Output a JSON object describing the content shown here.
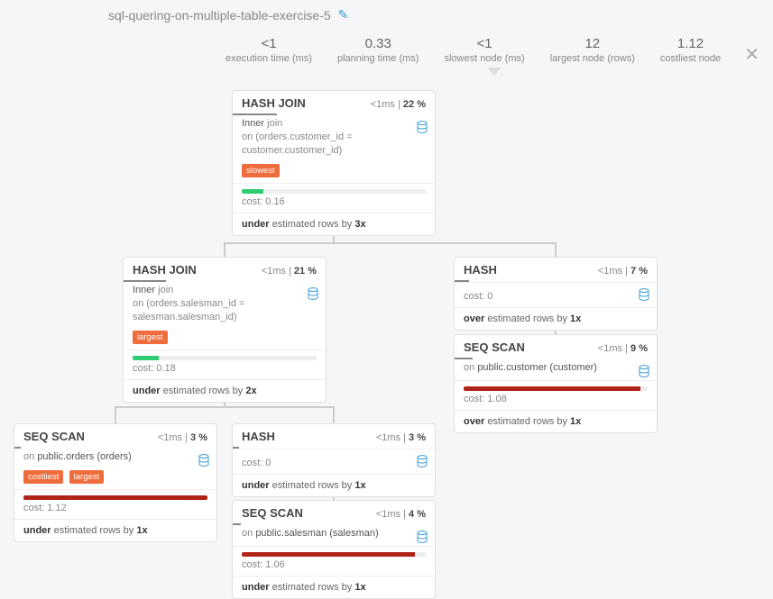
{
  "title": "sql-quering-on-multiple-table-exercise-5",
  "stats": {
    "exec": {
      "val": "<1",
      "label": "execution time (ms)"
    },
    "plan": {
      "val": "0.33",
      "label": "planning time (ms)"
    },
    "slow": {
      "val": "<1",
      "label": "slowest node (ms)"
    },
    "large": {
      "val": "12",
      "label": "largest node (rows)"
    },
    "costly": {
      "val": "1.12",
      "label": "costliest node"
    }
  },
  "badges": {
    "slowest": "slowest",
    "largest": "largest",
    "costliest": "costliest"
  },
  "nodes": {
    "n1": {
      "op": "HASH JOIN",
      "time": "<1ms",
      "pct": "22 %",
      "desc_kind": "Inner",
      "desc_kind2": "join",
      "desc_on": "on (orders.customer_id = customer.customer_id)",
      "badge_slowest": true,
      "bar_pct": 12,
      "bar_color": "#2ecc71",
      "cost": "0.16",
      "est_dir": "under",
      "est_tail": "estimated rows by",
      "est_x": "3x"
    },
    "n2": {
      "op": "HASH JOIN",
      "time": "<1ms",
      "pct": "21 %",
      "desc_kind": "Inner",
      "desc_kind2": "join",
      "desc_on": "on (orders.salesman_id = salesman.salesman_id)",
      "badge_largest": true,
      "bar_pct": 14,
      "bar_color": "#2ecc71",
      "cost": "0.18",
      "est_dir": "under",
      "est_tail": "estimated rows by",
      "est_x": "2x"
    },
    "n3": {
      "op": "HASH",
      "time": "<1ms",
      "pct": "7 %",
      "bar_pct": 4,
      "bar_color": "#2ecc71",
      "cost": "0",
      "est_dir": "over",
      "est_tail": "estimated rows by",
      "est_x": "1x"
    },
    "n4": {
      "op": "SEQ SCAN",
      "time": "<1ms",
      "pct": "9 %",
      "scan_on_prefix": "on",
      "scan_on": "public.customer (customer)",
      "bar_pct": 96,
      "bar_color": "#b02418",
      "cost": "1.08",
      "est_dir": "over",
      "est_tail": "estimated rows by",
      "est_x": "1x"
    },
    "n5": {
      "op": "SEQ SCAN",
      "time": "<1ms",
      "pct": "3 %",
      "scan_on_prefix": "on",
      "scan_on": "public.orders (orders)",
      "badge_costliest": true,
      "badge_largest": true,
      "bar_pct": 100,
      "bar_color": "#b02418",
      "cost": "1.12",
      "est_dir": "under",
      "est_tail": "estimated rows by",
      "est_x": "1x"
    },
    "n6": {
      "op": "HASH",
      "time": "<1ms",
      "pct": "3 %",
      "bar_pct": 4,
      "bar_color": "#2ecc71",
      "cost": "0",
      "est_dir": "under",
      "est_tail": "estimated rows by",
      "est_x": "1x"
    },
    "n7": {
      "op": "SEQ SCAN",
      "time": "<1ms",
      "pct": "4 %",
      "scan_on_prefix": "on",
      "scan_on": "public.salesman (salesman)",
      "bar_pct": 94,
      "bar_color": "#b02418",
      "cost": "1.06",
      "est_dir": "under",
      "est_tail": "estimated rows by",
      "est_x": "1x"
    }
  },
  "labels": {
    "cost_prefix": "cost:"
  }
}
